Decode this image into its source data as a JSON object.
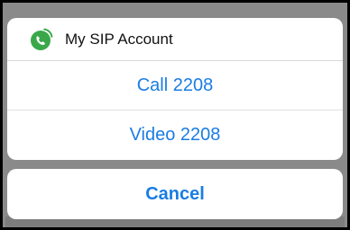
{
  "header": {
    "title": "My SIP Account",
    "icon": "phone-signal-icon",
    "icon_color": "#3aa84a"
  },
  "options": {
    "call_label": "Call 2208",
    "video_label": "Video 2208"
  },
  "cancel": {
    "label": "Cancel"
  },
  "colors": {
    "accent": "#1a7de3",
    "overlay": "#8a8a8a",
    "sheet": "#ffffff"
  }
}
